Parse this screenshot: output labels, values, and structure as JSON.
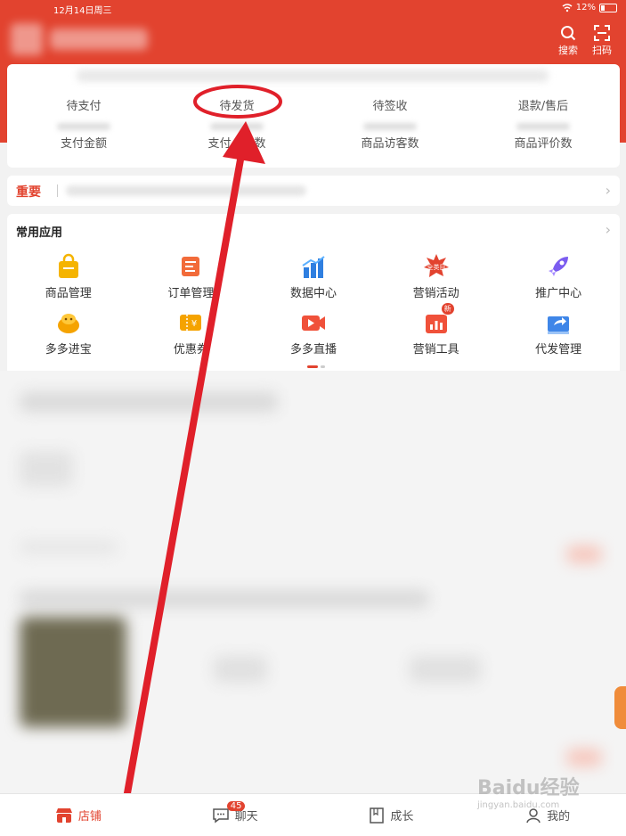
{
  "status_bar": {
    "time": "12月14日周三",
    "battery": "12%"
  },
  "header": {
    "search_label": "搜索",
    "scan_label": "扫码",
    "colors": {
      "brand": "#e2432f"
    }
  },
  "orders": {
    "row1": [
      {
        "label": "待支付"
      },
      {
        "label": "待发货"
      },
      {
        "label": "待签收"
      },
      {
        "label": "退款/售后"
      }
    ],
    "row2": [
      {
        "label": "支付金额"
      },
      {
        "label": "支付　　数"
      },
      {
        "label": "商品访客数"
      },
      {
        "label": "商品评价数"
      }
    ]
  },
  "notice": {
    "label": "重要"
  },
  "apps": {
    "title": "常用应用",
    "items": [
      {
        "label": "商品管理",
        "icon": "shopping-bag-icon"
      },
      {
        "label": "订单管理",
        "icon": "order-scroll-icon"
      },
      {
        "label": "数据中心",
        "icon": "bar-chart-icon"
      },
      {
        "label": "营销活动",
        "icon": "promo-burst-icon",
        "badge": "全类目"
      },
      {
        "label": "推广中心",
        "icon": "rocket-icon"
      },
      {
        "label": "多多进宝",
        "icon": "treasure-icon"
      },
      {
        "label": "优惠券",
        "icon": "coupon-icon"
      },
      {
        "label": "多多直播",
        "icon": "live-video-icon"
      },
      {
        "label": "营销工具",
        "icon": "marketing-tool-icon",
        "badge": "新"
      },
      {
        "label": "代发管理",
        "icon": "dropship-box-icon"
      }
    ]
  },
  "tabbar": {
    "items": [
      {
        "label": "店铺",
        "icon": "store-icon",
        "active": true
      },
      {
        "label": "聊天",
        "icon": "chat-icon",
        "badge": "45"
      },
      {
        "label": "成长",
        "icon": "book-icon"
      },
      {
        "label": "我的",
        "icon": "profile-icon"
      }
    ]
  },
  "watermark": {
    "text": "Baidu经验",
    "sub": "jingyan.baidu.com"
  }
}
